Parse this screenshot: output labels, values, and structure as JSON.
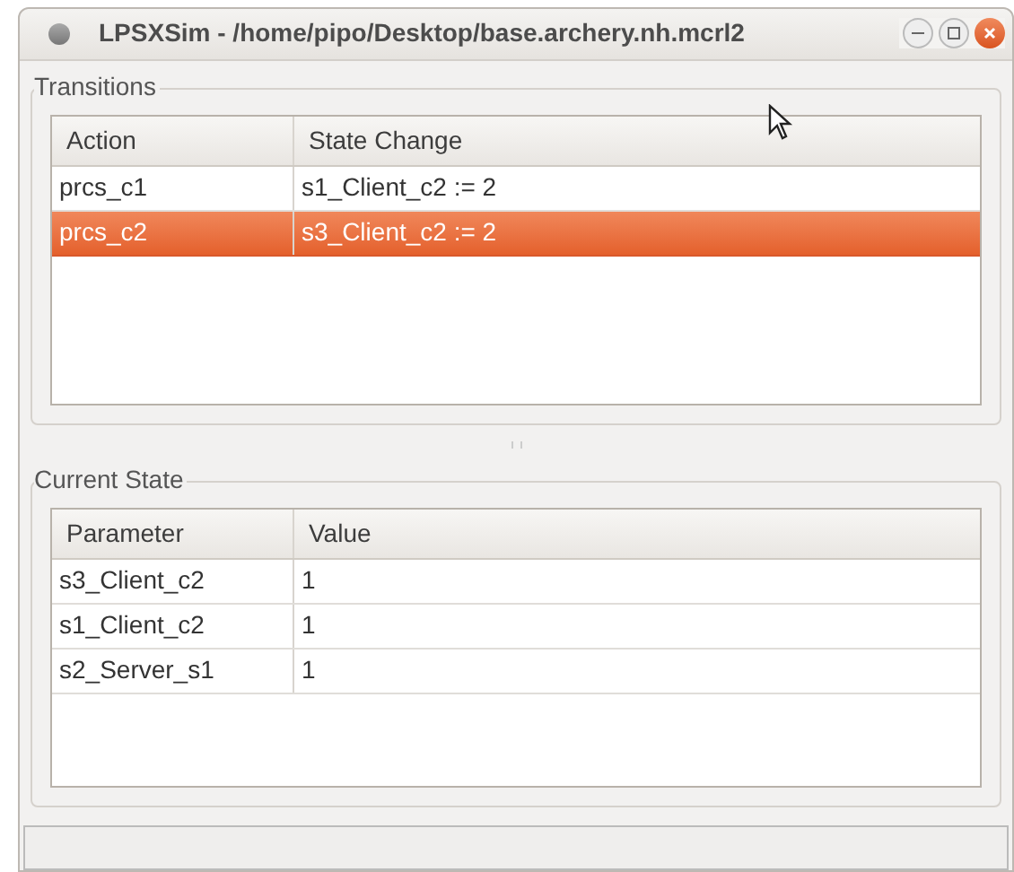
{
  "window": {
    "title": "LPSXSim - /home/pipo/Desktop/base.archery.nh.mcrl2"
  },
  "transitions": {
    "title": "Transitions",
    "columns": [
      "Action",
      "State Change"
    ],
    "rows": [
      {
        "cells": [
          "prcs_c1",
          "s1_Client_c2 := 2"
        ],
        "selected": false
      },
      {
        "cells": [
          "prcs_c2",
          "s3_Client_c2 := 2"
        ],
        "selected": true
      }
    ]
  },
  "current_state": {
    "title": "Current State",
    "columns": [
      "Parameter",
      "Value"
    ],
    "rows": [
      {
        "cells": [
          "s3_Client_c2",
          "1"
        ]
      },
      {
        "cells": [
          "s1_Client_c2",
          "1"
        ]
      },
      {
        "cells": [
          "s2_Server_s1",
          "1"
        ]
      }
    ]
  }
}
